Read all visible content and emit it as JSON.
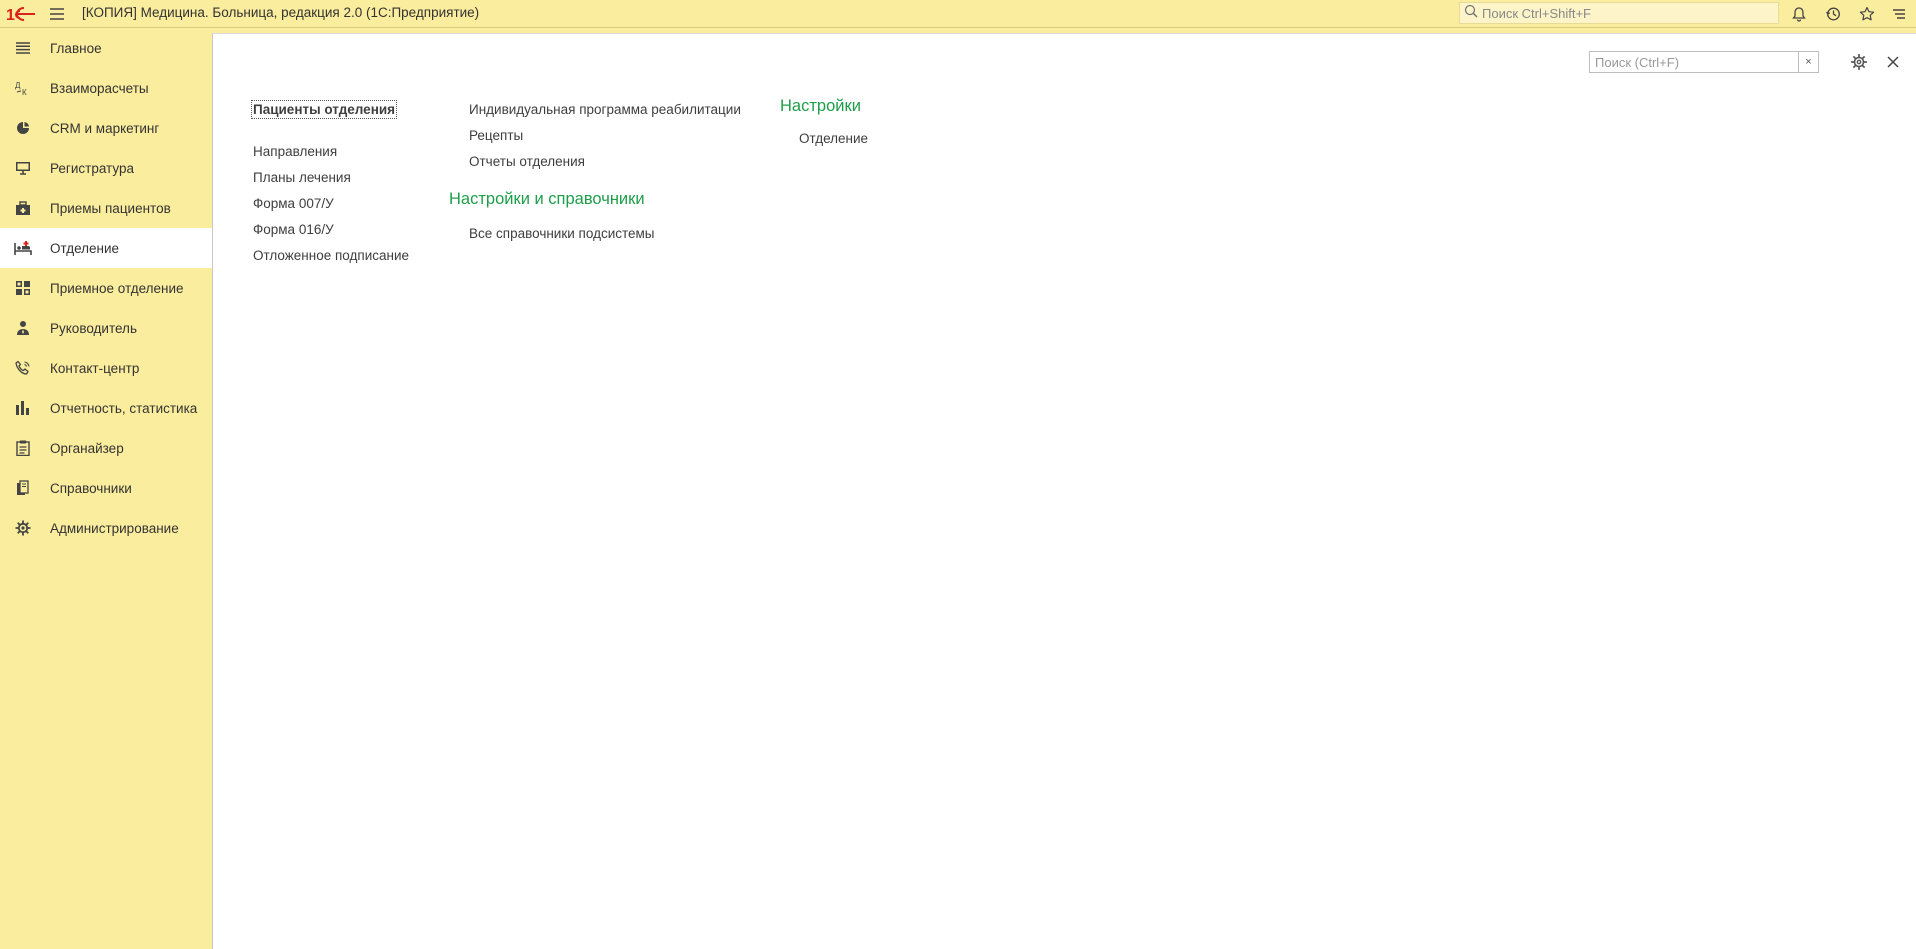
{
  "app": {
    "title": "[КОПИЯ] Медицина. Больница, редакция 2.0  (1С:Предприятие)",
    "global_search_placeholder": "Поиск Ctrl+Shift+F"
  },
  "sidebar": {
    "items": [
      {
        "label": "Главное",
        "icon": "list-icon"
      },
      {
        "label": "Взаиморасчеты",
        "icon": "settlements-icon"
      },
      {
        "label": "CRM и маркетинг",
        "icon": "pie-chart-icon"
      },
      {
        "label": "Регистратура",
        "icon": "monitor-icon"
      },
      {
        "label": "Приемы пациентов",
        "icon": "briefcase-icon"
      },
      {
        "label": "Отделение",
        "icon": "hospital-bed-icon",
        "active": true
      },
      {
        "label": "Приемное отделение",
        "icon": "reception-icon"
      },
      {
        "label": "Руководитель",
        "icon": "manager-icon"
      },
      {
        "label": "Контакт-центр",
        "icon": "phone-icon"
      },
      {
        "label": "Отчетность, статистика",
        "icon": "bar-chart-icon"
      },
      {
        "label": "Органайзер",
        "icon": "clipboard-icon"
      },
      {
        "label": "Справочники",
        "icon": "books-icon"
      },
      {
        "label": "Администрирование",
        "icon": "gear-icon"
      }
    ]
  },
  "form": {
    "search_placeholder": "Поиск (Ctrl+F)",
    "clear_label": "×"
  },
  "links": {
    "col1": [
      "Пациенты отделения",
      "Направления",
      "Планы лечения",
      "Форма 007/У",
      "Форма 016/У",
      "Отложенное подписание"
    ],
    "col2": [
      "Индивидуальная программа реабилитации",
      "Рецепты",
      "Отчеты отделения"
    ],
    "settings_refs_title": "Настройки и справочники",
    "settings_refs_items": [
      "Все справочники подсистемы"
    ],
    "settings_title": "Настройки",
    "settings_items": [
      "Отделение"
    ]
  },
  "colors": {
    "panel": "#fbed9e",
    "section_title": "#1e9e4a",
    "active_item": "#ffffff"
  }
}
